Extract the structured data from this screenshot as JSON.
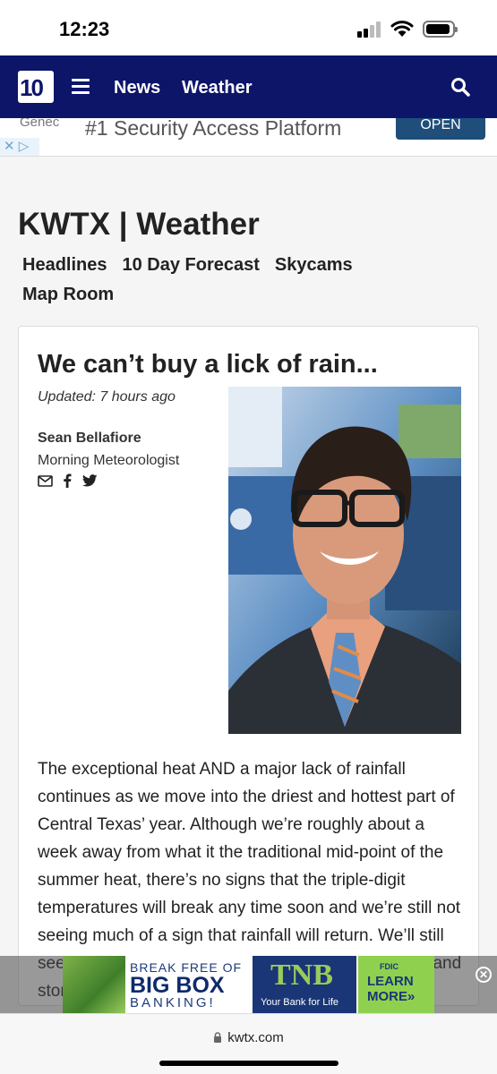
{
  "status_bar": {
    "time": "12:23"
  },
  "nav": {
    "logo_text": "10",
    "links": [
      "News",
      "Weather"
    ]
  },
  "top_ad": {
    "brand_fragment": "Genec",
    "text": "#1 Security Access Platform",
    "button": "OPEN"
  },
  "page": {
    "title": "KWTX | Weather",
    "subnav": [
      "Headlines",
      "10 Day Forecast",
      "Skycams",
      "Map Room"
    ]
  },
  "article": {
    "headline": "We can’t buy a lick of rain...",
    "updated": "Updated: 7 hours ago",
    "author": "Sean Bellafiore",
    "role": "Morning Meteorologist",
    "social_icons": [
      "email-icon",
      "facebook-icon",
      "twitter-icon"
    ],
    "body": "The exceptional heat AND a major lack of rainfall continues as we move into the driest and hottest part of Central Texas’ year. Although we’re roughly about a week away from what it the traditional mid-point of the summer heat, there’s no signs that the triple-digit temperatures will break any time soon and we’re still not seeing much of a sign that rainfall will return. We’ll still see a slight low-end chance for a couple of showers and storms"
  },
  "bottom_ad": {
    "line1": "BREAK FREE OF",
    "line2": "BIG BOX",
    "line3": "BANKING!",
    "logo": "TNB",
    "tagline": "Your Bank for Life",
    "fdic": "FDIC",
    "cta": "LEARN MORE»"
  },
  "url_bar": {
    "url": "kwtx.com"
  },
  "colors": {
    "nav_bg": "#0d1569",
    "accent_green": "#8fd14f"
  }
}
